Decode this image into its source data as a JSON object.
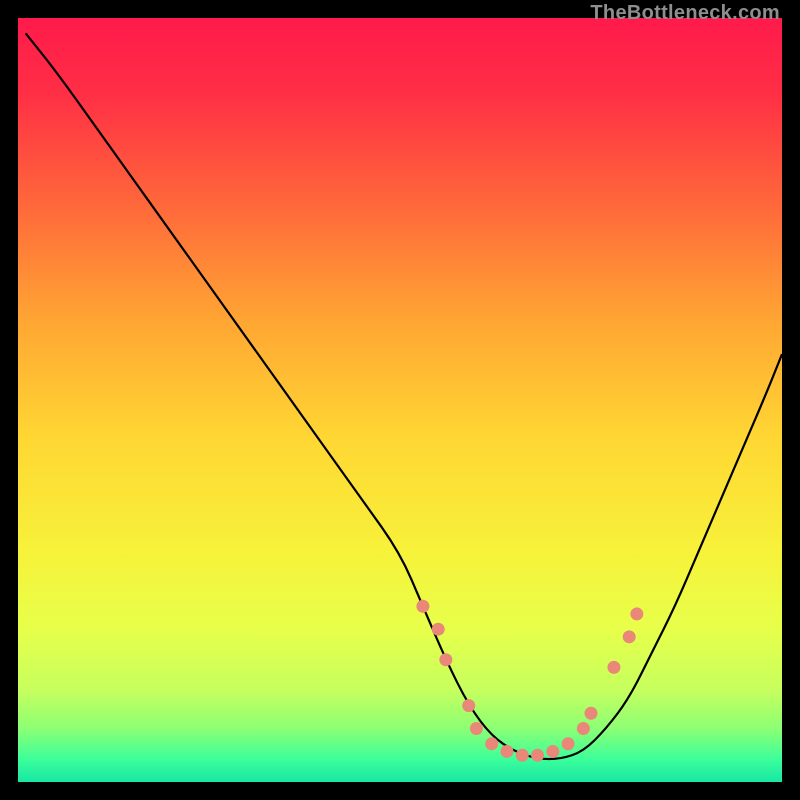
{
  "watermark": "TheBottleneck.com",
  "chart_data": {
    "type": "line",
    "title": "",
    "xlabel": "",
    "ylabel": "",
    "xlim": [
      0,
      100
    ],
    "ylim": [
      0,
      100
    ],
    "grid": false,
    "legend": false,
    "series": [
      {
        "name": "curve",
        "x": [
          1,
          5,
          10,
          15,
          20,
          25,
          30,
          35,
          40,
          45,
          50,
          53,
          56,
          59,
          62,
          65,
          68,
          71,
          74,
          77,
          80,
          83,
          86,
          89,
          92,
          95,
          98,
          100
        ],
        "y": [
          98,
          93,
          86,
          79,
          72,
          65,
          58,
          51,
          44,
          37,
          30,
          23,
          16,
          10,
          6,
          4,
          3,
          3,
          4,
          7,
          11,
          17,
          23,
          30,
          37,
          44,
          51,
          56
        ]
      }
    ],
    "markers": [
      {
        "x": 53,
        "y": 23
      },
      {
        "x": 55,
        "y": 20
      },
      {
        "x": 56,
        "y": 16
      },
      {
        "x": 59,
        "y": 10
      },
      {
        "x": 60,
        "y": 7
      },
      {
        "x": 62,
        "y": 5
      },
      {
        "x": 64,
        "y": 4
      },
      {
        "x": 66,
        "y": 3.5
      },
      {
        "x": 68,
        "y": 3.5
      },
      {
        "x": 70,
        "y": 4
      },
      {
        "x": 72,
        "y": 5
      },
      {
        "x": 74,
        "y": 7
      },
      {
        "x": 75,
        "y": 9
      },
      {
        "x": 78,
        "y": 15
      },
      {
        "x": 80,
        "y": 19
      },
      {
        "x": 81,
        "y": 22
      }
    ],
    "gradient_stops": [
      {
        "offset": 0.0,
        "color": "#ff1a4b"
      },
      {
        "offset": 0.1,
        "color": "#ff2f45"
      },
      {
        "offset": 0.25,
        "color": "#ff6a3a"
      },
      {
        "offset": 0.4,
        "color": "#ffa733"
      },
      {
        "offset": 0.55,
        "color": "#ffd733"
      },
      {
        "offset": 0.7,
        "color": "#f7f23a"
      },
      {
        "offset": 0.8,
        "color": "#e7ff4a"
      },
      {
        "offset": 0.88,
        "color": "#c6ff5e"
      },
      {
        "offset": 0.93,
        "color": "#8cff74"
      },
      {
        "offset": 0.97,
        "color": "#3cff9a"
      },
      {
        "offset": 1.0,
        "color": "#18e7a5"
      }
    ],
    "marker_color": "#e98779",
    "curve_color": "#000000"
  }
}
